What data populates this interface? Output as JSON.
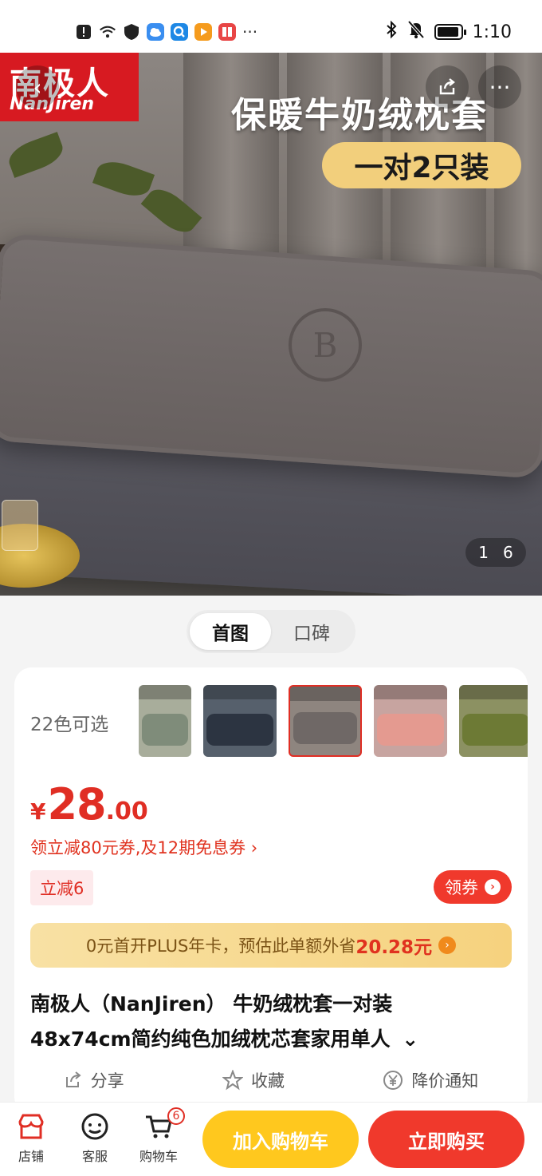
{
  "status_bar": {
    "time": "1:10",
    "left_icons": [
      "alert-icon",
      "wifi-icon",
      "shield-icon",
      "cloud-app-icon",
      "search-app-icon",
      "video-app-icon",
      "book-app-icon",
      "more-dots-icon"
    ],
    "right_icons": [
      "bluetooth-icon",
      "mute-icon",
      "battery-icon"
    ],
    "more_dots": "···"
  },
  "hero": {
    "brand_cn": "南极人",
    "brand_en": "NanJiren",
    "title": "保暖牛奶绒枕套",
    "pill": "一对2只装",
    "counter_current": "1",
    "counter_total": "6",
    "back_glyph": "‹",
    "share_glyph": "⇪",
    "more_glyph": "···"
  },
  "view_toggle": {
    "tabs": [
      {
        "label": "首图",
        "active": true
      },
      {
        "label": "口碑",
        "active": false
      }
    ]
  },
  "product": {
    "color_count": "22色可选",
    "thumbnail_colors": [
      "#7f8c7a",
      "#2c3441",
      "#6f6866",
      "#e49a90",
      "#6d7a35"
    ],
    "price_currency": "¥",
    "price_integer": "28",
    "price_decimal": ".00",
    "coupon_line": "领立减80元券,及12期免息券 ›",
    "discount_tag": "立减6",
    "claim_button": "领券",
    "plus_text": "0元首开PLUS年卡，预估此单额外省",
    "plus_amount": "20.28元",
    "title_line1": "南极人（NanJiren） 牛奶绒枕套一对装",
    "title_line2": "48x74cm简约纯色加绒枕芯套家用单人",
    "expand_glyph": "⌄"
  },
  "actions": {
    "share": "分享",
    "favorite": "收藏",
    "price_alert": "降价通知"
  },
  "bottom_nav": {
    "store": "店铺",
    "service": "客服",
    "cart": "购物车",
    "cart_badge": "6",
    "add_to_cart": "加入购物车",
    "buy_now": "立即购买"
  },
  "colors": {
    "accent_red": "#e02e24",
    "cart_yellow": "#ffc81e",
    "buy_red": "#f0392c"
  }
}
